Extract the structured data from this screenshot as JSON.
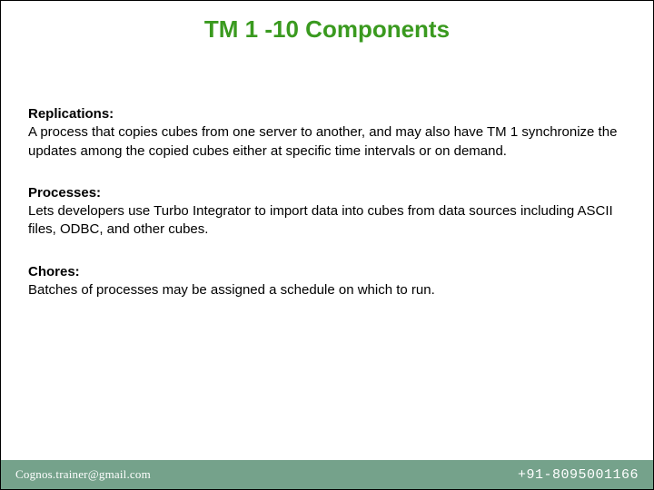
{
  "title": "TM 1 -10 Components",
  "sections": [
    {
      "heading": "Replications:",
      "body": "A process that copies cubes from one server to another, and may also have TM 1 synchronize the updates among the copied cubes either at specific time intervals or on demand."
    },
    {
      "heading": "Processes:",
      "body": "Lets developers use Turbo Integrator to import data into cubes from data sources including ASCII files, ODBC, and other cubes."
    },
    {
      "heading": "Chores:",
      "body": "Batches of processes may be assigned a schedule on which to run."
    }
  ],
  "footer": {
    "email": "Cognos.trainer@gmail.com",
    "phone": "+91-8095001166"
  }
}
